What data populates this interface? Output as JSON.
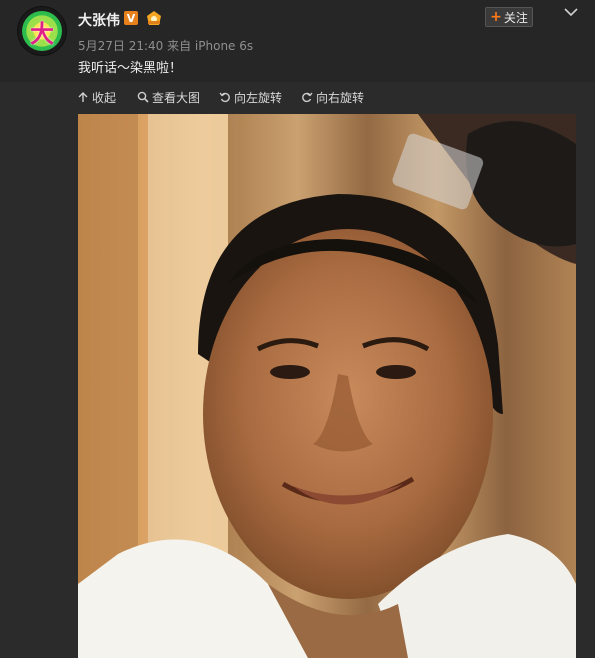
{
  "post": {
    "username": "大张伟",
    "verified_badge": "V",
    "avatar_glyph": "大",
    "meta": "5月27日 21:40 来自 iPhone 6s",
    "text": "我听话～染黑啦！"
  },
  "actions": {
    "follow_label": "关注"
  },
  "toolbar": {
    "collapse": "收起",
    "view_large": "查看大图",
    "rotate_left": "向左旋转",
    "rotate_right": "向右旋转"
  },
  "colors": {
    "background": "#2b2b2b",
    "accent_orange": "#ff7a1a",
    "badge_orange": "#e8801c"
  },
  "icons": [
    "collapse-icon",
    "zoom-icon",
    "rotate-left-icon",
    "rotate-right-icon",
    "chevron-down-icon",
    "vip-icon",
    "verified-icon"
  ]
}
